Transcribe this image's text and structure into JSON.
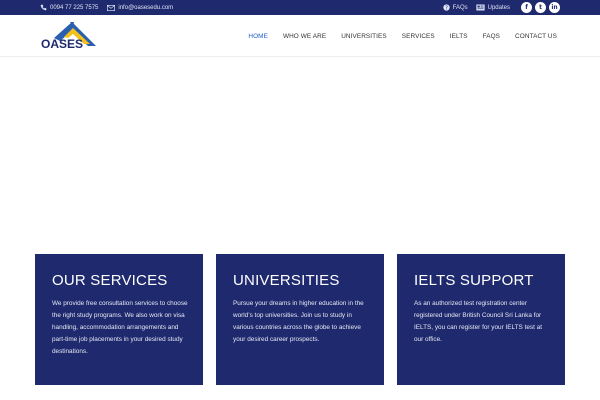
{
  "topbar": {
    "phone": "0094 77 225 7575",
    "email": "info@oasesedu.com",
    "faqs_link": "FAQs",
    "updates_link": "Updates",
    "social": [
      {
        "name": "facebook",
        "glyph": "f"
      },
      {
        "name": "twitter",
        "glyph": "t"
      },
      {
        "name": "linkedin",
        "glyph": "in"
      }
    ]
  },
  "header": {
    "logo_text": "OASES",
    "nav": [
      {
        "label": "HOME",
        "active": true
      },
      {
        "label": "WHO WE ARE",
        "active": false
      },
      {
        "label": "UNIVERSITIES",
        "active": false
      },
      {
        "label": "SERVICES",
        "active": false
      },
      {
        "label": "IELTS",
        "active": false
      },
      {
        "label": "FAQS",
        "active": false
      },
      {
        "label": "CONTACT US",
        "active": false
      }
    ]
  },
  "cards": [
    {
      "title": "OUR SERVICES",
      "text": "We provide free consultation services to choose the right study programs. We also work on visa handling, accommodation arrangements and part-time job placements in your desired study destinations."
    },
    {
      "title": "UNIVERSITIES",
      "text": "Pursue your dreams in higher education in the world’s top universities. Join us to study in various countries across the globe to achieve your desired career prospects."
    },
    {
      "title": "IELTS SUPPORT",
      "text": "As an authorized test registration center registered under British Council Sri Lanka for IELTS, you can register for your IELTS test at our office."
    }
  ],
  "colors": {
    "brand_navy": "#1f2a6e",
    "nav_active": "#1f5cc8",
    "logo_yellow": "#f2c21a",
    "logo_blue": "#2a5fb0"
  }
}
